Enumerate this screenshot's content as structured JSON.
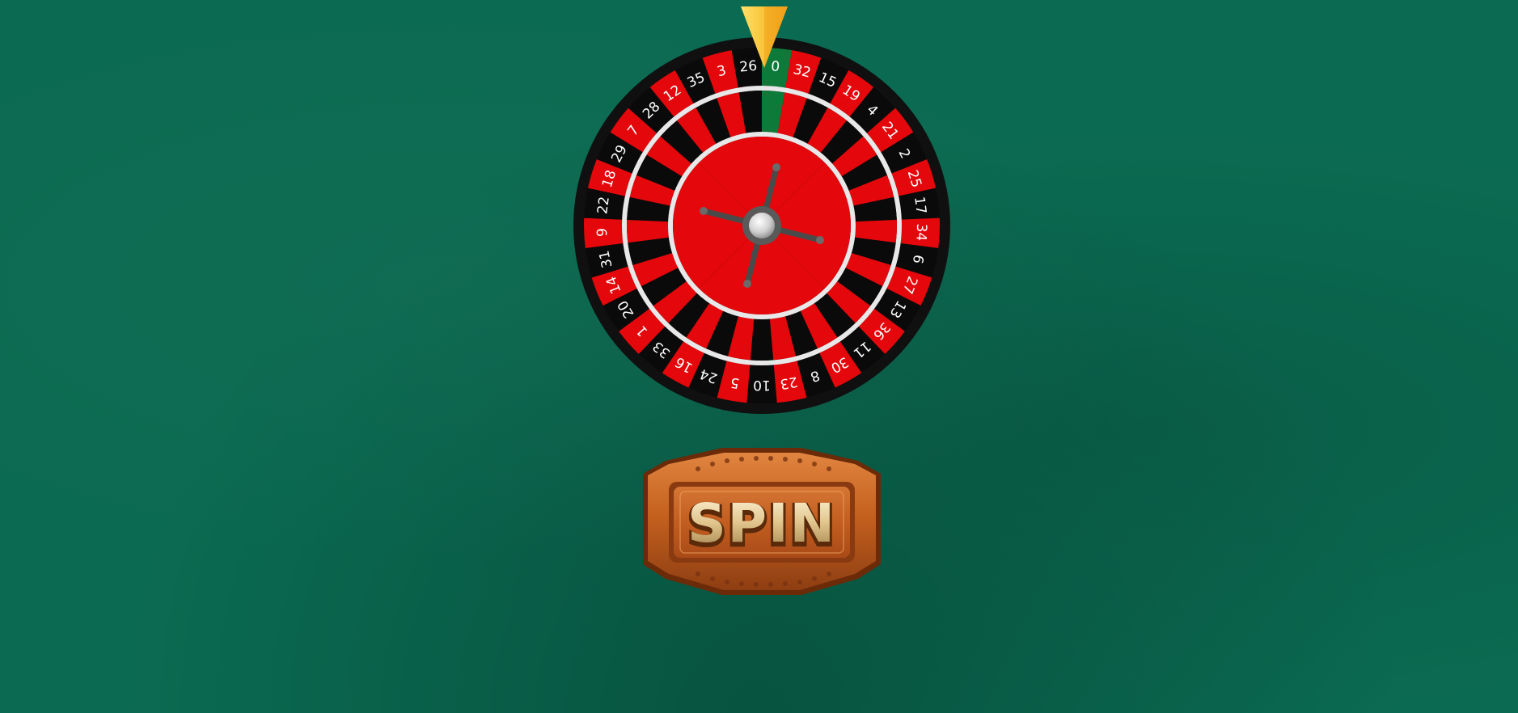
{
  "wheel": {
    "numbers": [
      0,
      32,
      15,
      19,
      4,
      21,
      2,
      25,
      17,
      34,
      6,
      27,
      13,
      36,
      11,
      30,
      8,
      23,
      10,
      5,
      24,
      16,
      33,
      1,
      20,
      14,
      31,
      9,
      22,
      18,
      29,
      7,
      28,
      12,
      35,
      3,
      26
    ],
    "colors": {
      "red": "#e4070b",
      "black": "#0a0a0a",
      "green": "#0e7a3a",
      "rim": "#101010",
      "ring": "#e8e8e8"
    }
  },
  "spin_button": {
    "label": "SPIN"
  },
  "colors": {
    "felt": "#0b6b52",
    "pointer_light": "#ffe16a",
    "pointer_dark": "#f29a12",
    "button_wood": "#c76424",
    "button_text": "#e7d4a4"
  }
}
